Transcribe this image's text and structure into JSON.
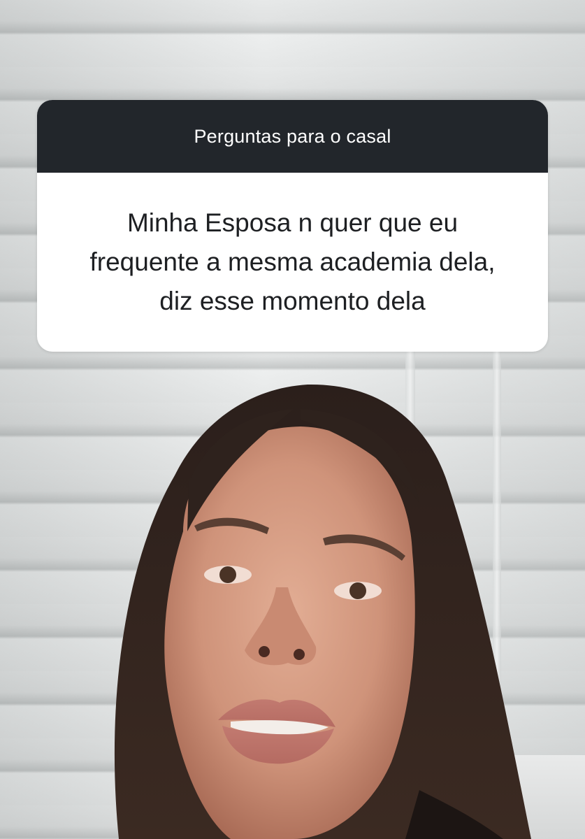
{
  "story": {
    "question_sticker": {
      "title": "Perguntas para o casal",
      "question": "Minha Esposa n quer que eu frequente a mesma academia dela, diz esse momento dela"
    },
    "colors": {
      "sticker_header": "#22262b",
      "sticker_body": "#ffffff",
      "sticker_title_text": "#ffffff",
      "sticker_question_text": "#1d1f22"
    }
  }
}
